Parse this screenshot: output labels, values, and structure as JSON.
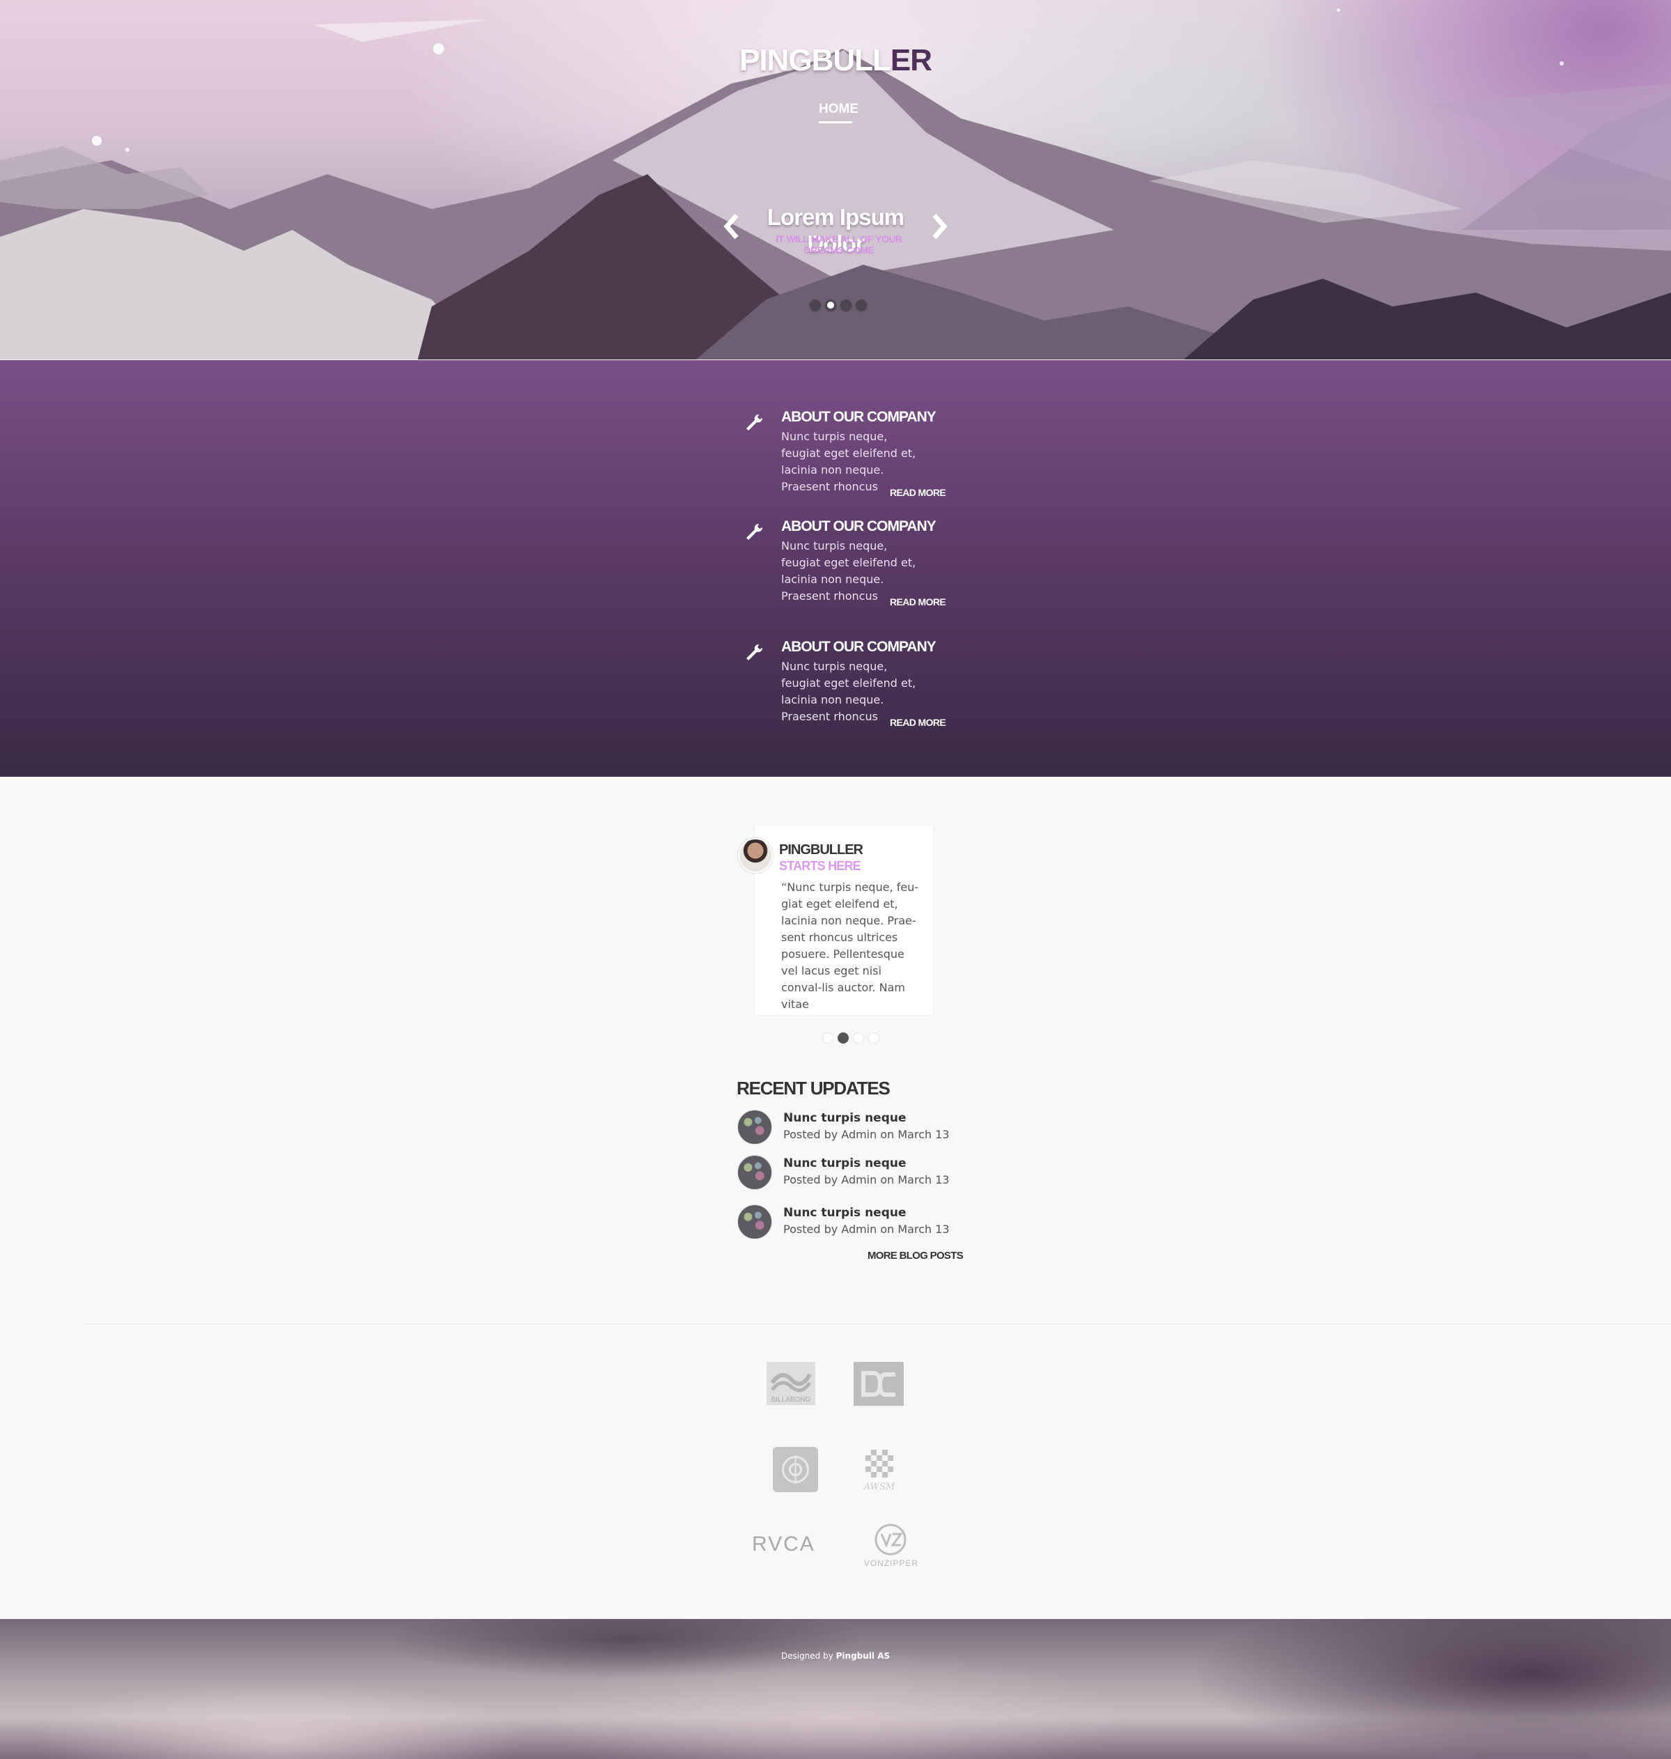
{
  "header": {
    "brand_main": "PINGBULL",
    "brand_accent": "ER",
    "nav": {
      "home": "HOME"
    }
  },
  "slider": {
    "title": "Lorem Ipsum Dolor",
    "subtitle": "IT WILL MAKE ALL OF YOUR DREAMS COME",
    "slide_count": 4,
    "active_slide": 2
  },
  "services": [
    {
      "title": "ABOUT OUR COMPANY",
      "text": "Nunc turpis neque, feugiat eget eleifend et, lacinia non neque. Praesent rhoncus",
      "link": "READ MORE"
    },
    {
      "title": "ABOUT OUR COMPANY",
      "text": "Nunc turpis neque, feugiat eget eleifend et, lacinia non neque. Praesent rhoncus",
      "link": "READ MORE"
    },
    {
      "title": "ABOUT OUR COMPANY",
      "text": "Nunc turpis neque, feugiat eget eleifend et, lacinia non neque. Praesent rhoncus",
      "link": "READ MORE"
    }
  ],
  "testimonial": {
    "name": "PINGBULLER",
    "role": "STARTS HERE",
    "quote": "“Nunc turpis neque, feu-giat eget eleifend et, lacinia non neque. Prae-sent rhoncus ultrices posuere. Pellentesque vel lacus eget nisi conval-lis auctor. Nam vitae",
    "slide_count": 4,
    "active_slide": 2
  },
  "recent_updates": {
    "heading": "RECENT UPDATES",
    "items": [
      {
        "title": "Nunc turpis neque",
        "meta": "Posted by Admin on March 13"
      },
      {
        "title": "Nunc turpis neque",
        "meta": "Posted by Admin on March 13"
      },
      {
        "title": "Nunc turpis neque",
        "meta": "Posted by Admin on March 13"
      }
    ],
    "more_link": "MORE BLOG POSTS"
  },
  "partners": {
    "billabong": "BILLABONG",
    "rvca": "RVCA",
    "aws": "AWSM",
    "vonzipper": "VONZIPPER"
  },
  "footer": {
    "credit_prefix": "Designed by",
    "credit_name": "Pingbull AS"
  },
  "colors": {
    "accent": "#d793e8",
    "brand_accent": "#4e3058",
    "services_top": "#7a5087",
    "services_bottom": "#3a2a44"
  }
}
